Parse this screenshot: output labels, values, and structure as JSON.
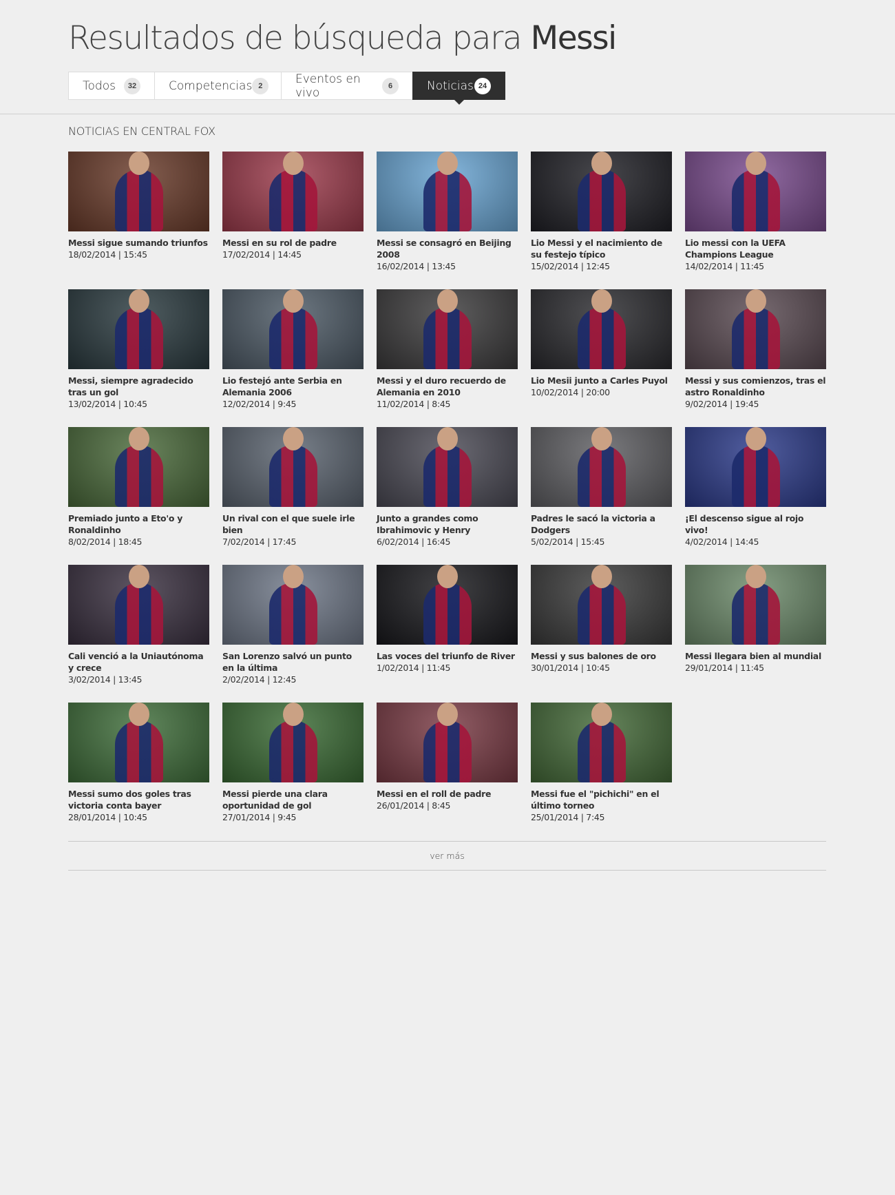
{
  "header": {
    "title_prefix": "Resultados de búsqueda para",
    "query": "Messi"
  },
  "tabs": [
    {
      "label": "Todos",
      "count": "32",
      "active": false
    },
    {
      "label": "Competencias",
      "count": "2",
      "active": false
    },
    {
      "label": "Eventos en vivo",
      "count": "6",
      "active": false
    },
    {
      "label": "Noticias",
      "count": "24",
      "active": true
    }
  ],
  "section": {
    "title": "NOTICIAS EN CENTRAL FOX"
  },
  "news": [
    {
      "title": "Messi sigue sumando triunfos",
      "date": "18/02/2014 | 15:45",
      "bg": "#6a3b2a"
    },
    {
      "title": "Messi en su rol de padre",
      "date": "17/02/2014 | 14:45",
      "bg": "#9e3b4c"
    },
    {
      "title": "Messi se consagró en Beijing 2008",
      "date": "16/02/2014 | 13:45",
      "bg": "#6aa6d4"
    },
    {
      "title": "Lio Messi y el nacimiento de su festejo típico",
      "date": "15/02/2014 | 12:45",
      "bg": "#1f1f25"
    },
    {
      "title": "Lio  messi con la UEFA Champions League",
      "date": "14/02/2014 | 11:45",
      "bg": "#7a4b8e"
    },
    {
      "title": "Messi, siempre agradecido tras un gol",
      "date": "13/02/2014 | 10:45",
      "bg": "#2a3a3f"
    },
    {
      "title": "Lio festejó ante Serbia en Alemania 2006",
      "date": "12/02/2014 | 9:45",
      "bg": "#4d5a66"
    },
    {
      "title": "Messi y el duro recuerdo de Alemania en 2010",
      "date": "11/02/2014 | 8:45",
      "bg": "#3c3b3c"
    },
    {
      "title": "Lio Mesii junto a Carles Puyol",
      "date": "10/02/2014 | 20:00",
      "bg": "#2a2a2e"
    },
    {
      "title": "Messi y sus comienzos, tras el astro Ronaldinho",
      "date": "9/02/2014 | 19:45",
      "bg": "#5a4a52"
    },
    {
      "title": "Premiado junto a Eto'o y Ronaldinho",
      "date": "8/02/2014 | 18:45",
      "bg": "#4a6a3a"
    },
    {
      "title": "Un rival con el que suele irle bien",
      "date": "7/02/2014 | 17:45",
      "bg": "#5b6470"
    },
    {
      "title": "Junto a grandes como Ibrahimovic y Henry",
      "date": "6/02/2014 | 16:45",
      "bg": "#4b4a55"
    },
    {
      "title": "Padres le sacó la victoria a Dodgers",
      "date": "5/02/2014 | 15:45",
      "bg": "#5e5e62"
    },
    {
      "title": "¡El descenso sigue al rojo vivo!",
      "date": "4/02/2014 | 14:45",
      "bg": "#2b3a8a"
    },
    {
      "title": "Cali venció a la Uniautónoma y crece",
      "date": "3/02/2014 | 13:45",
      "bg": "#3a3040"
    },
    {
      "title": "San Lorenzo salvó un punto en la última",
      "date": "2/02/2014 | 12:45",
      "bg": "#6f7888"
    },
    {
      "title": "Las voces del triunfo de River",
      "date": "1/02/2014 | 11:45",
      "bg": "#18181c"
    },
    {
      "title": "Messi y sus balones de oro",
      "date": "30/01/2014 | 10:45",
      "bg": "#3a3a3a"
    },
    {
      "title": "Messi llegara bien al mundial",
      "date": "29/01/2014 | 11:45",
      "bg": "#6c8a6a"
    },
    {
      "title": "Messi sumo dos goles tras victoria conta bayer",
      "date": "28/01/2014 | 10:45",
      "bg": "#3f6e3a"
    },
    {
      "title": "Messi pierde una clara oportunidad de gol",
      "date": "27/01/2014 | 9:45",
      "bg": "#3a6b34"
    },
    {
      "title": "Messi en el roll de padre",
      "date": "26/01/2014 | 8:45",
      "bg": "#7a3a44"
    },
    {
      "title": "Messi fue el \"pichichi\" en el último torneo",
      "date": "25/01/2014 | 7:45",
      "bg": "#446a38"
    }
  ],
  "more": {
    "label": "ver más"
  }
}
